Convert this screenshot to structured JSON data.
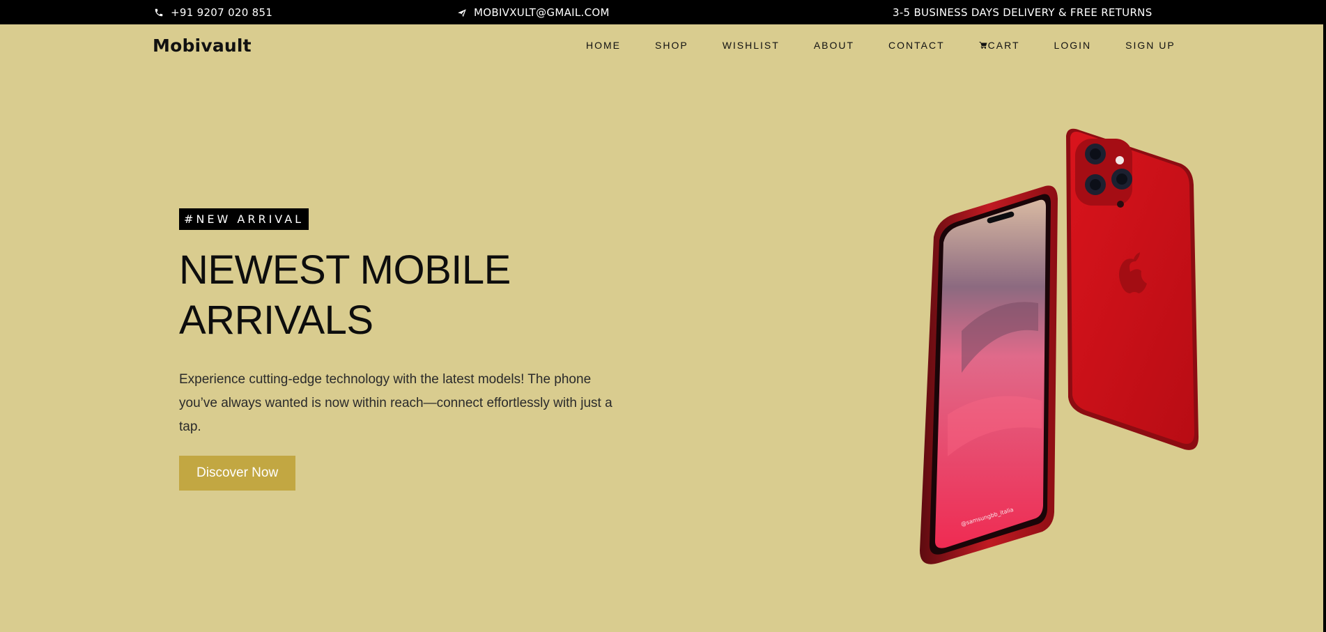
{
  "topbar": {
    "phone": "+91 9207 020 851",
    "email": "MOBIVXULT@GMAIL.COM",
    "promo": "3-5 BUSINESS DAYS DELIVERY & FREE RETURNS"
  },
  "nav": {
    "brand": "Mobivault",
    "links": {
      "home": "HOME",
      "shop": "SHOP",
      "wishlist": "WISHLIST",
      "about": "ABOUT",
      "contact": "CONTACT",
      "cart": "CART",
      "login": "LOGIN",
      "signup": "SIGN UP"
    }
  },
  "hero": {
    "tag": "#NEW ARRIVAL",
    "headline_line1": "NEWEST MOBILE",
    "headline_line2": "ARRIVALS",
    "description": "Experience cutting-edge technology with the latest models! The phone you’ve always wanted is now within reach—connect effortlessly with just a tap.",
    "cta": "Discover Now",
    "phone_screen_text": "@samsungbb_italia"
  },
  "colors": {
    "background": "#d9cc8f",
    "topbar": "#000000",
    "cta": "#c2a742",
    "phone_red": "#c8141d"
  },
  "icons": {
    "phone": "phone-icon",
    "email": "paper-plane-icon",
    "cart": "cart-icon"
  }
}
